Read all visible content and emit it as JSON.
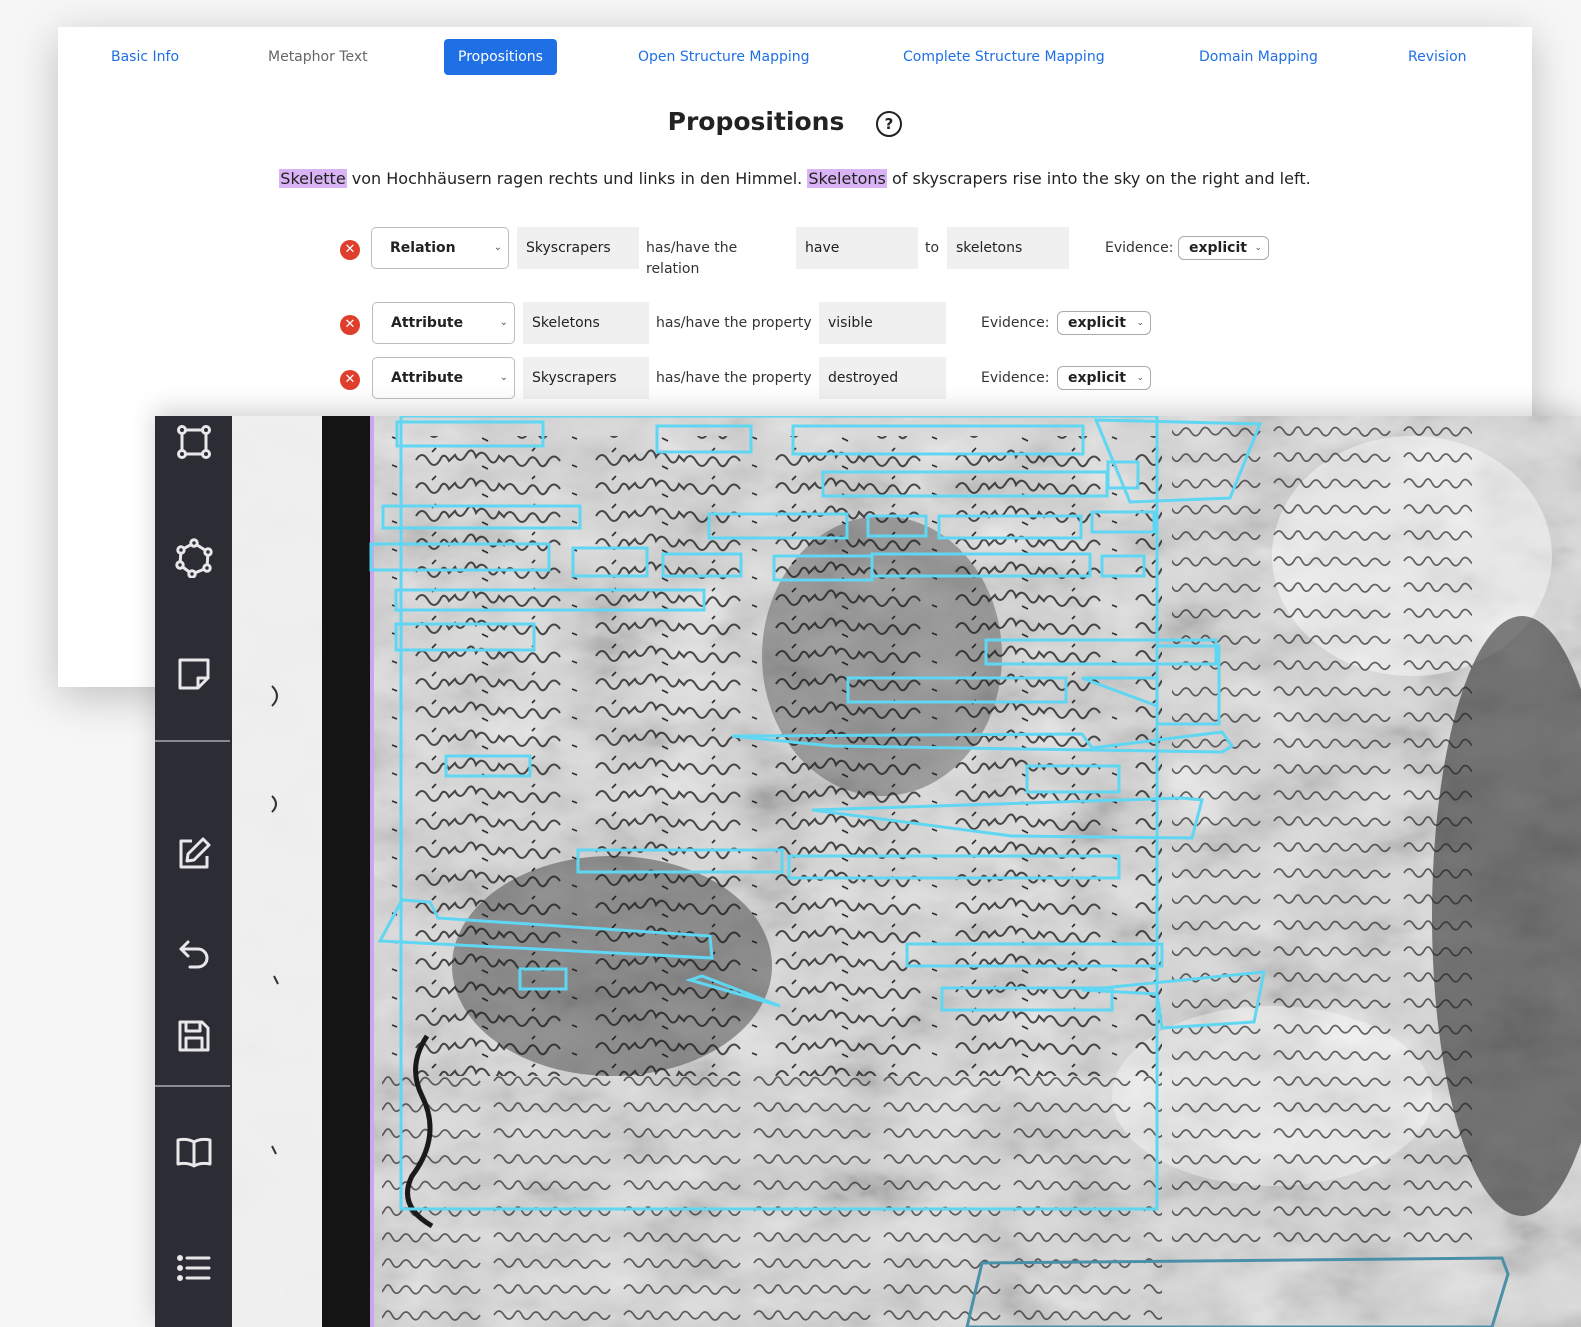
{
  "tabs": [
    {
      "label": "Basic Info"
    },
    {
      "label": "Metaphor Text"
    },
    {
      "label": "Propositions"
    },
    {
      "label": "Open Structure Mapping"
    },
    {
      "label": "Complete Structure Mapping"
    },
    {
      "label": "Domain Mapping"
    },
    {
      "label": "Revision"
    }
  ],
  "page": {
    "title": "Propositions",
    "help_icon": "?"
  },
  "sentence": {
    "de_highlight": "Skelette",
    "de_rest": " von Hochhäusern ragen rechts und links in den Himmel. ",
    "en_highlight": "Skeletons",
    "en_rest": " of skyscrapers rise into the sky on the right and left."
  },
  "propositions": [
    {
      "type": "Relation",
      "subject": "Skyscrapers",
      "connector": "has/have the relation",
      "value": "have",
      "to": "to",
      "object": "skeletons",
      "evidence_label": "Evidence:",
      "evidence": "explicit"
    },
    {
      "type": "Attribute",
      "subject": "Skeletons",
      "connector": "has/have the property",
      "value": "visible",
      "evidence_label": "Evidence:",
      "evidence": "explicit"
    },
    {
      "type": "Attribute",
      "subject": "Skyscrapers",
      "connector": "has/have the property",
      "value": "destroyed",
      "evidence_label": "Evidence:",
      "evidence": "explicit"
    }
  ],
  "icons": {
    "remove": "close-circle-icon",
    "dropdown": "chevron-down-icon",
    "tools": [
      "bounding-box-icon",
      "polygon-icon",
      "sticky-note-icon",
      "edit-icon",
      "undo-icon",
      "save-icon",
      "book-icon",
      "list-icon"
    ]
  },
  "colors": {
    "accent": "#1f6fe5",
    "highlight": "#d9b3f5",
    "remove": "#e03e2d",
    "annotation": "#5fd6f2",
    "annotation_dark": "#4a90a8",
    "toolbar": "#2c2d34"
  }
}
